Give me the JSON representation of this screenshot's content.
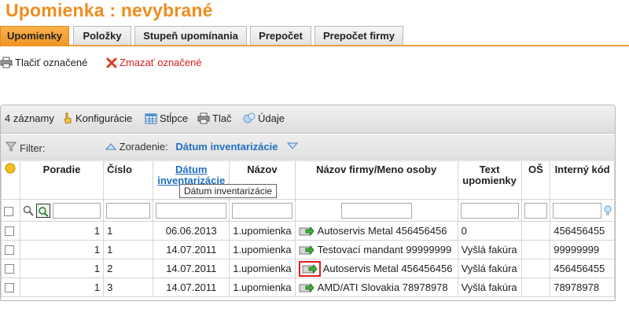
{
  "page": {
    "title": "Upomienka :  nevybrané"
  },
  "tabs": [
    {
      "label": "Upomienky",
      "active": true
    },
    {
      "label": "Položky"
    },
    {
      "label": "Stupeň upomínania"
    },
    {
      "label": "Prepočet"
    },
    {
      "label": "Prepočet firmy"
    }
  ],
  "toolbar": {
    "print_label": "Tlačiť označené",
    "delete_label": "Zmazať označené"
  },
  "grid_toolbar": {
    "count": "4 záznamy",
    "config": "Konfigurácie",
    "columns": "Stĺpce",
    "print": "Tlač",
    "data": "Údaje"
  },
  "filter_bar": {
    "filter_label": "Filter:",
    "sort_label": "Zoradenie:",
    "sort_value": "Dátum inventarizácie"
  },
  "columns": {
    "poradie": "Poradie",
    "cislo": "Číslo",
    "datum": "Dátum inventarizácie",
    "nazov": "Názov",
    "firma": "Názov firmy/Meno osoby",
    "text": "Text upomienky",
    "os": "OŠ",
    "kod": "Interný kód"
  },
  "tooltip": "Dátum inventarizácie",
  "rows": [
    {
      "poradie": "1",
      "cislo": "1",
      "datum": "06.06.2013",
      "nazov": "1.upomienka",
      "firma": "Autoservis Metal 456456456",
      "text": "0",
      "os": "",
      "kod": "456456455"
    },
    {
      "poradie": "1",
      "cislo": "1",
      "datum": "14.07.2011",
      "nazov": "1.upomienka",
      "firma": "Testovací mandant 99999999",
      "text": "Vyšlá fakúra",
      "os": "",
      "kod": "99999999"
    },
    {
      "poradie": "1",
      "cislo": "2",
      "datum": "14.07.2011",
      "nazov": "1.upomienka",
      "firma": "Autoservis Metal 456456456",
      "text": "Vyšlá fakúra",
      "os": "",
      "kod": "456456455"
    },
    {
      "poradie": "1",
      "cislo": "3",
      "datum": "14.07.2011",
      "nazov": "1.upomienka",
      "firma": "AMD/ATI Slovakia 78978978",
      "text": "Vyšlá fakúra",
      "os": "",
      "kod": "78978978"
    }
  ],
  "colors": {
    "accent": "#f08c1e",
    "link": "#1f6fc4",
    "delete": "#d62020",
    "highlight": "#e02020"
  }
}
